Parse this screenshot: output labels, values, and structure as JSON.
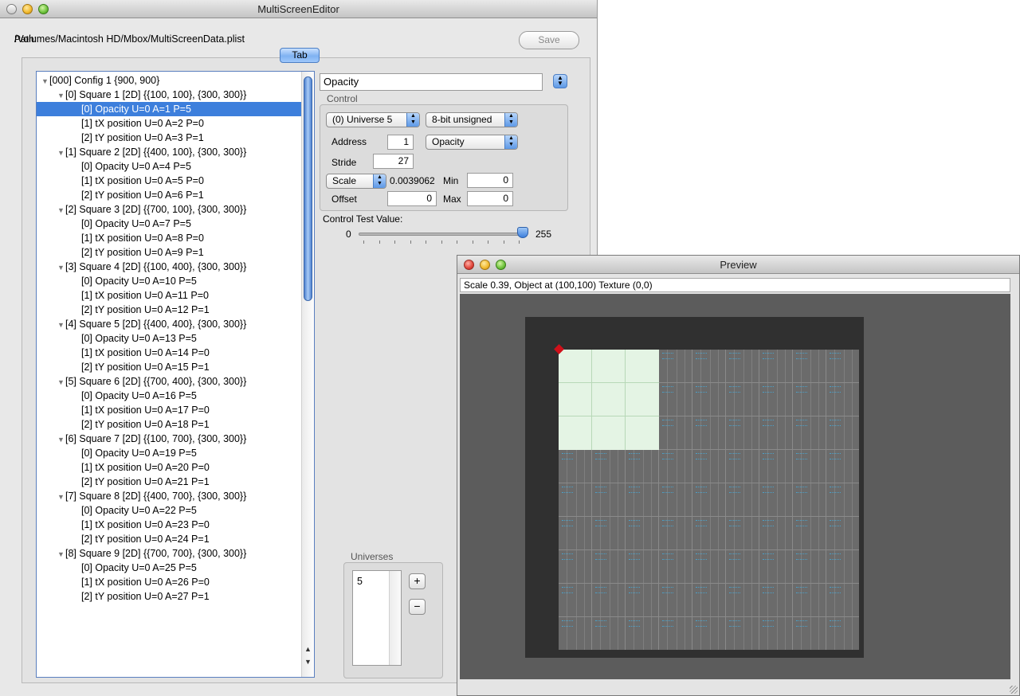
{
  "main_window": {
    "title": "MultiScreenEditor",
    "path_label": "Path:",
    "path_value": "/Volumes/Macintosh HD/Mbox/MultiScreenData.plist",
    "save_label": "Save",
    "tab_label": "Tab"
  },
  "outline": {
    "rows": [
      {
        "indent": 0,
        "expander": true,
        "text": "[000] Config 1 {900, 900}"
      },
      {
        "indent": 1,
        "expander": true,
        "text": "[0] Square 1  [2D] {{100, 100}, {300, 300}}"
      },
      {
        "indent": 2,
        "expander": false,
        "text": "[0] Opacity U=0 A=1 P=5",
        "selected": true
      },
      {
        "indent": 2,
        "expander": false,
        "text": "[1] tX position U=0 A=2 P=0"
      },
      {
        "indent": 2,
        "expander": false,
        "text": "[2] tY position U=0 A=3 P=1"
      },
      {
        "indent": 1,
        "expander": true,
        "text": "[1] Square 2  [2D] {{400, 100}, {300, 300}}"
      },
      {
        "indent": 2,
        "expander": false,
        "text": "[0] Opacity U=0 A=4 P=5"
      },
      {
        "indent": 2,
        "expander": false,
        "text": "[1] tX position U=0 A=5 P=0"
      },
      {
        "indent": 2,
        "expander": false,
        "text": "[2] tY position U=0 A=6 P=1"
      },
      {
        "indent": 1,
        "expander": true,
        "text": "[2] Square 3  [2D] {{700, 100}, {300, 300}}"
      },
      {
        "indent": 2,
        "expander": false,
        "text": "[0] Opacity U=0 A=7 P=5"
      },
      {
        "indent": 2,
        "expander": false,
        "text": "[1] tX position U=0 A=8 P=0"
      },
      {
        "indent": 2,
        "expander": false,
        "text": "[2] tY position U=0 A=9 P=1"
      },
      {
        "indent": 1,
        "expander": true,
        "text": "[3] Square 4  [2D] {{100, 400}, {300, 300}}"
      },
      {
        "indent": 2,
        "expander": false,
        "text": "[0] Opacity U=0 A=10 P=5"
      },
      {
        "indent": 2,
        "expander": false,
        "text": "[1] tX position U=0 A=11 P=0"
      },
      {
        "indent": 2,
        "expander": false,
        "text": "[2] tY position U=0 A=12 P=1"
      },
      {
        "indent": 1,
        "expander": true,
        "text": "[4] Square 5  [2D] {{400, 400}, {300, 300}}"
      },
      {
        "indent": 2,
        "expander": false,
        "text": "[0] Opacity U=0 A=13 P=5"
      },
      {
        "indent": 2,
        "expander": false,
        "text": "[1] tX position U=0 A=14 P=0"
      },
      {
        "indent": 2,
        "expander": false,
        "text": "[2] tY position U=0 A=15 P=1"
      },
      {
        "indent": 1,
        "expander": true,
        "text": "[5] Square 6  [2D] {{700, 400}, {300, 300}}"
      },
      {
        "indent": 2,
        "expander": false,
        "text": "[0] Opacity U=0 A=16 P=5"
      },
      {
        "indent": 2,
        "expander": false,
        "text": "[1] tX position U=0 A=17 P=0"
      },
      {
        "indent": 2,
        "expander": false,
        "text": "[2] tY position U=0 A=18 P=1"
      },
      {
        "indent": 1,
        "expander": true,
        "text": "[6] Square 7  [2D] {{100, 700}, {300, 300}}"
      },
      {
        "indent": 2,
        "expander": false,
        "text": "[0] Opacity U=0 A=19 P=5"
      },
      {
        "indent": 2,
        "expander": false,
        "text": "[1] tX position U=0 A=20 P=0"
      },
      {
        "indent": 2,
        "expander": false,
        "text": "[2] tY position U=0 A=21 P=1"
      },
      {
        "indent": 1,
        "expander": true,
        "text": "[7] Square 8  [2D] {{400, 700}, {300, 300}}"
      },
      {
        "indent": 2,
        "expander": false,
        "text": "[0] Opacity U=0 A=22 P=5"
      },
      {
        "indent": 2,
        "expander": false,
        "text": "[1] tX position U=0 A=23 P=0"
      },
      {
        "indent": 2,
        "expander": false,
        "text": "[2] tY position U=0 A=24 P=1"
      },
      {
        "indent": 1,
        "expander": true,
        "text": "[8] Square 9  [2D] {{700, 700}, {300, 300}}"
      },
      {
        "indent": 2,
        "expander": false,
        "text": "[0] Opacity U=0 A=25 P=5"
      },
      {
        "indent": 2,
        "expander": false,
        "text": "[1] tX position U=0 A=26 P=0"
      },
      {
        "indent": 2,
        "expander": false,
        "text": "[2] tY position U=0 A=27 P=1"
      }
    ]
  },
  "inspector": {
    "name_value": "Opacity",
    "control_box_label": "Control",
    "universe_popup": "(0) Universe 5",
    "format_popup": "8-bit unsigned",
    "address_label": "Address",
    "address_value": "1",
    "param_popup": "Opacity",
    "stride_label": "Stride",
    "stride_value": "27",
    "scale_popup": "Scale",
    "scale_value": "0.0039062",
    "min_label": "Min",
    "min_value": "0",
    "offset_label": "Offset",
    "offset_value": "0",
    "max_label": "Max",
    "max_value": "0",
    "test_label": "Control Test Value:",
    "slider_min": "0",
    "slider_max": "255",
    "slider_fraction": 1.0,
    "universes_label": "Universes",
    "universes_list": [
      "5"
    ],
    "add_label": "+",
    "remove_label": "−"
  },
  "preview_window": {
    "title": "Preview",
    "status": "Scale 0.39, Object at (100,100) Texture (0,0)"
  },
  "colors": {
    "selection": "#3d7fdc",
    "canvas": "#5c5c5c",
    "marker": "#d0101a"
  }
}
